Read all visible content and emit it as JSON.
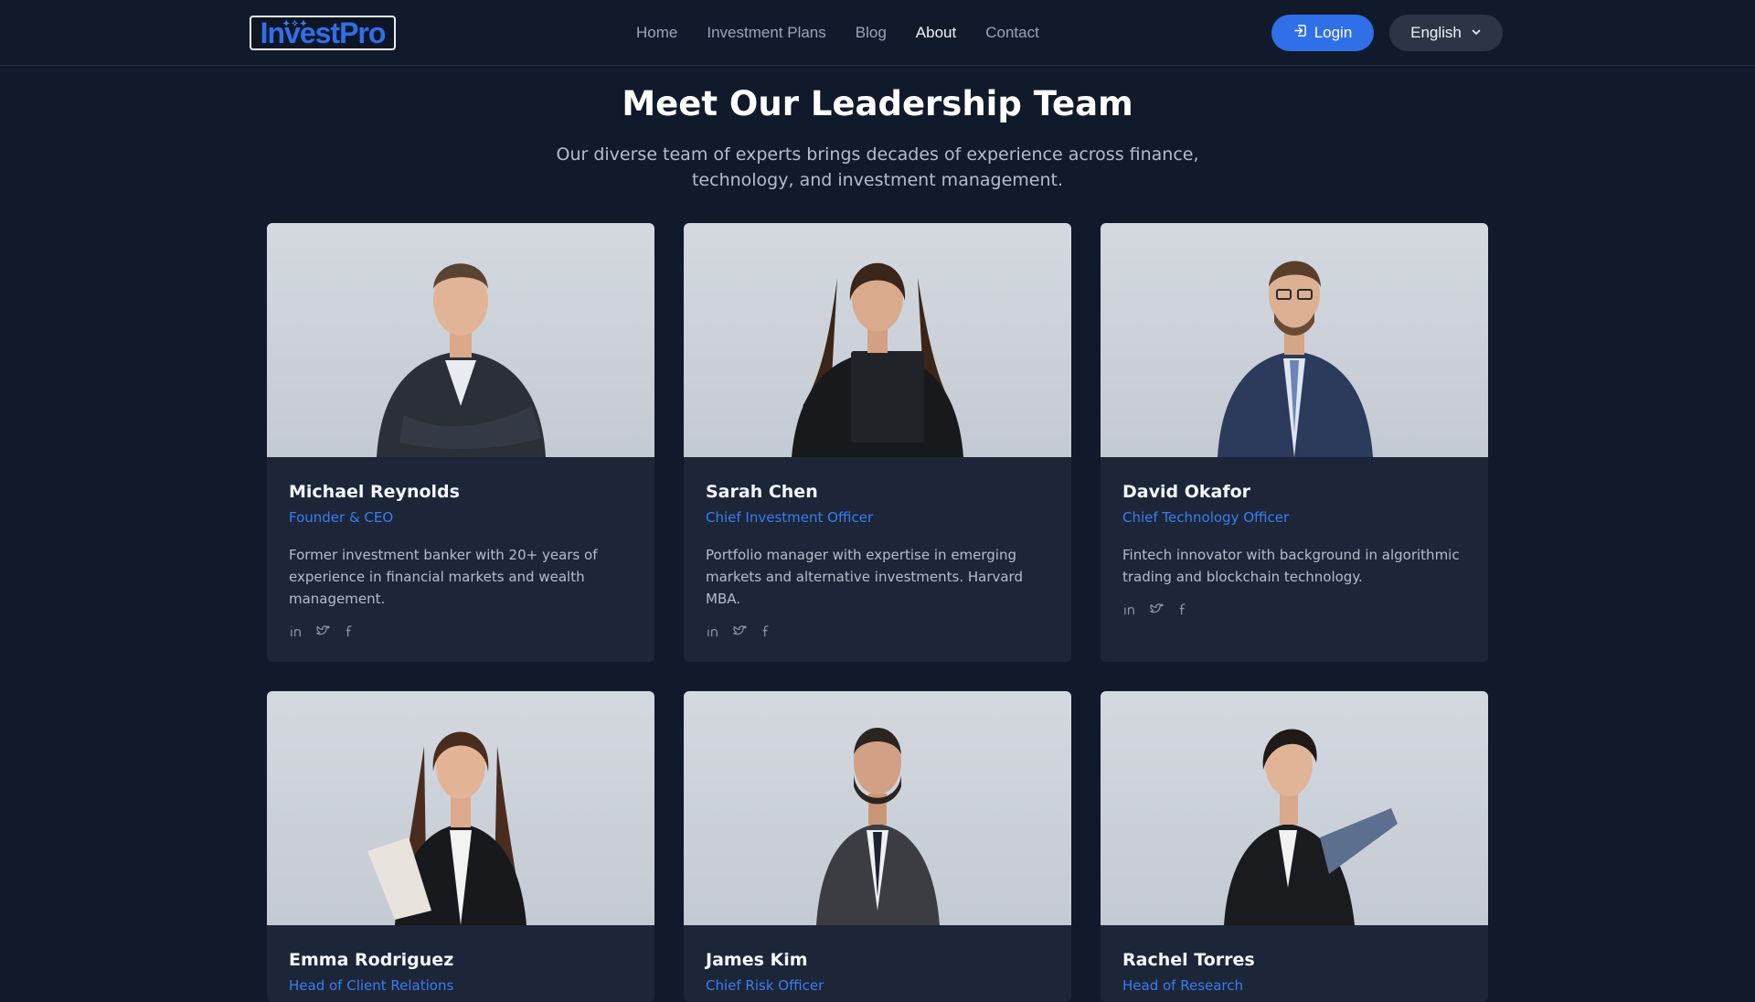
{
  "header": {
    "logo": "InvestPro",
    "nav": [
      "Home",
      "Investment Plans",
      "Blog",
      "About",
      "Contact"
    ],
    "active_nav": "About",
    "login_label": "Login",
    "language": "English"
  },
  "hero": {
    "title": "Meet Our Leadership Team",
    "subtitle": "Our diverse team of experts brings decades of experience across finance, technology, and investment management."
  },
  "team": [
    {
      "name": "Michael Reynolds",
      "role": "Founder & CEO",
      "bio": "Former investment banker with 20+ years of experience in financial markets and wealth management."
    },
    {
      "name": "Sarah Chen",
      "role": "Chief Investment Officer",
      "bio": "Portfolio manager with expertise in emerging markets and alternative investments. Harvard MBA."
    },
    {
      "name": "David Okafor",
      "role": "Chief Technology Officer",
      "bio": "Fintech innovator with background in algorithmic trading and blockchain technology."
    },
    {
      "name": "Emma Rodriguez",
      "role": "Head of Client Relations",
      "bio": ""
    },
    {
      "name": "James Kim",
      "role": "Chief Risk Officer",
      "bio": ""
    },
    {
      "name": "Rachel Torres",
      "role": "Head of Research",
      "bio": ""
    }
  ],
  "icons": {
    "social": [
      "linkedin-icon",
      "twitter-icon",
      "facebook-icon"
    ],
    "login": "login-icon",
    "language_toggle": "chevron-down-icon"
  },
  "colors": {
    "background": "#111a2b",
    "card": "#1c2638",
    "accent": "#2f6fe8",
    "role_text": "#3b7cf0"
  }
}
